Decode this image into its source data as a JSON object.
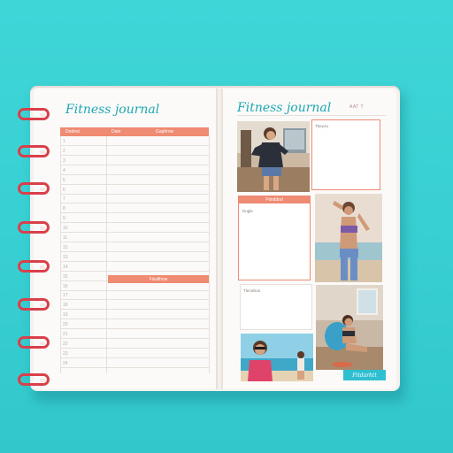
{
  "left_page": {
    "title": "Fitness journal",
    "table_headers": [
      "Dodest",
      "Date",
      "Gaphrow"
    ],
    "subheader": "Fisstlhow",
    "row_numbers": [
      "1",
      "2",
      "3",
      "4",
      "5",
      "6",
      "7",
      "8",
      "9",
      "10",
      "11",
      "12",
      "13",
      "14",
      "15",
      "16",
      "17",
      "18",
      "19",
      "20",
      "21",
      "22",
      "23",
      "24"
    ]
  },
  "right_page": {
    "title": "Fitness journal",
    "page_label": "AAT T",
    "box_labels": {
      "top": "Tbeyou",
      "middle_header": "Ftinddod",
      "middle": "Dugle",
      "bottom": "Tlenniitos"
    },
    "photo_tag": "Fitdarhtt"
  },
  "colors": {
    "background": "#3fd6d8",
    "accent": "#ef8a73",
    "title": "#1fa7b4",
    "rings": "#d9404a"
  }
}
